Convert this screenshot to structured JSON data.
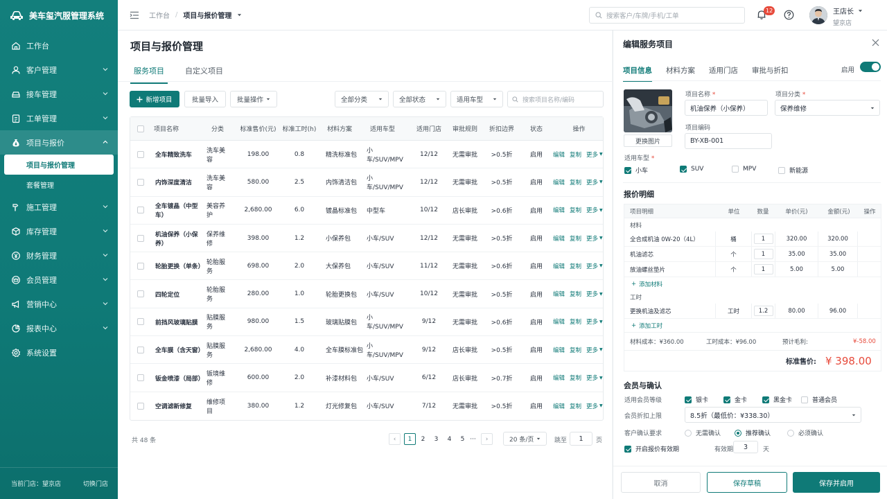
{
  "app": {
    "title": "美车玺汽服管理系统",
    "current_store_label": "当前门店：望京店",
    "switch_store": "切换门店"
  },
  "sidebar": {
    "items": [
      {
        "label": "工作台"
      },
      {
        "label": "客户管理"
      },
      {
        "label": "接车管理"
      },
      {
        "label": "工单管理"
      },
      {
        "label": "项目与报价"
      },
      {
        "label": "施工管理"
      },
      {
        "label": "库存管理"
      },
      {
        "label": "财务管理"
      },
      {
        "label": "会员管理"
      },
      {
        "label": "营销中心"
      },
      {
        "label": "报表中心"
      },
      {
        "label": "系统设置"
      }
    ],
    "sub_items": [
      {
        "label": "项目与报价管理"
      },
      {
        "label": "套餐管理"
      }
    ]
  },
  "topbar": {
    "breadcrumb": [
      "工作台",
      "项目与报价管理"
    ],
    "search_placeholder": "搜索客户/车牌/手机/工单",
    "notification_count": "12",
    "user_name": "王店长",
    "user_store": "望京店"
  },
  "page": {
    "title": "项目与报价管理",
    "tabs": [
      "服务项目",
      "自定义项目"
    ],
    "toolbar": {
      "add": "新增项目",
      "import": "批量导入",
      "batch": "批量操作",
      "category": "全部分类",
      "status": "全部状态",
      "vehicle": "适用车型",
      "search_placeholder": "搜索项目名称/编码"
    },
    "table": {
      "headers": [
        "项目名称",
        "分类",
        "标准售价(元)",
        "标准工时(h)",
        "材料方案",
        "适用车型",
        "适用门店",
        "审批规则",
        "折扣边界",
        "状态",
        "操作"
      ],
      "rows": [
        {
          "name": "全车精致洗车",
          "cat": "洗车美容",
          "price": "198.00",
          "hours": "0.8",
          "material": "精洗标准包",
          "vehicle": "小车/SUV/MPV",
          "stores": "12/12",
          "approval": "无需审批",
          "discount": ">0.5折",
          "status": "启用"
        },
        {
          "name": "内饰深度清洁",
          "cat": "洗车美容",
          "price": "580.00",
          "hours": "2.5",
          "material": "内饰清洁包",
          "vehicle": "小车/SUV/MPV",
          "stores": "12/12",
          "approval": "无需审批",
          "discount": ">0.5折",
          "status": "启用"
        },
        {
          "name": "全车镀晶（中型车）",
          "cat": "美容养护",
          "price": "2,680.00",
          "hours": "6.0",
          "material": "镀晶标准包",
          "vehicle": "中型车",
          "stores": "10/12",
          "approval": "店长审批",
          "discount": ">0.6折",
          "status": "启用"
        },
        {
          "name": "机油保养（小保养）",
          "cat": "保养维修",
          "price": "398.00",
          "hours": "1.2",
          "material": "小保养包",
          "vehicle": "小车/SUV",
          "stores": "12/12",
          "approval": "无需审批",
          "discount": ">0.5折",
          "status": "启用"
        },
        {
          "name": "轮胎更换（单条）",
          "cat": "轮胎服务",
          "price": "698.00",
          "hours": "2.0",
          "material": "大保养包",
          "vehicle": "小车/SUV",
          "stores": "11/12",
          "approval": "无需审批",
          "discount": ">0.6折",
          "status": "启用"
        },
        {
          "name": "四轮定位",
          "cat": "轮胎服务",
          "price": "280.00",
          "hours": "1.0",
          "material": "轮胎更换包",
          "vehicle": "小车/SUV",
          "stores": "10/12",
          "approval": "无需审批",
          "discount": ">0.5折",
          "status": "启用"
        },
        {
          "name": "前挡风玻璃贴膜",
          "cat": "贴膜服务",
          "price": "980.00",
          "hours": "1.5",
          "material": "玻璃贴膜包",
          "vehicle": "小车/SUV/MPV",
          "stores": "9/12",
          "approval": "无需审批",
          "discount": ">0.6折",
          "status": "启用"
        },
        {
          "name": "全车膜（含天窗）",
          "cat": "贴膜服务",
          "price": "2,680.00",
          "hours": "4.0",
          "material": "全车膜标准包",
          "vehicle": "小车/SUV/MPV",
          "stores": "9/12",
          "approval": "店长审批",
          "discount": ">0.5折",
          "status": "启用"
        },
        {
          "name": "钣金喷漆（局部）",
          "cat": "钣境维修",
          "price": "600.00",
          "hours": "2.0",
          "material": "补漆材料包",
          "vehicle": "小车/SUV",
          "stores": "6/12",
          "approval": "店长审批",
          "discount": ">0.7折",
          "status": "启用"
        },
        {
          "name": "空调滤新修复",
          "cat": "维修项目",
          "price": "380.00",
          "hours": "1.2",
          "material": "灯光修复包",
          "vehicle": "小车/SUV",
          "stores": "7/12",
          "approval": "无需审批",
          "discount": ">0.5折",
          "status": "启用"
        }
      ],
      "actions": {
        "edit": "编辑",
        "copy": "复制",
        "more": "更多"
      }
    },
    "pager": {
      "total": "共 48 条",
      "pages": [
        "1",
        "2",
        "3",
        "4",
        "5"
      ],
      "ellipsis": "···",
      "per_page": "20 条/页",
      "jump_label": "跳至",
      "jump_value": "1",
      "page_unit": "页"
    }
  },
  "panel": {
    "title": "编辑服务项目",
    "tabs": [
      "项目信息",
      "材料方案",
      "适用门店",
      "审批与折扣"
    ],
    "enable_label": "启用",
    "photo_btn": "更换图片",
    "name_label": "项目名称",
    "name_value": "机油保养（小保养）",
    "cat_label": "项目分类",
    "cat_value": "保养维修",
    "code_label": "项目编码",
    "code_value": "BY-XB-001",
    "vehicle_label": "适用车型",
    "vehicles": [
      {
        "label": "小车",
        "checked": true
      },
      {
        "label": "SUV",
        "checked": true
      },
      {
        "label": "MPV",
        "checked": false
      },
      {
        "label": "新能源",
        "checked": false
      }
    ],
    "quote": {
      "title": "报价明细",
      "headers": [
        "项目明细",
        "单位",
        "数量",
        "单价(元)",
        "金额(元)",
        "操作"
      ],
      "material_group": "材料",
      "materials": [
        {
          "name": "全合成机油 0W-20（4L）",
          "unit": "桶",
          "qty": "1",
          "price": "320.00",
          "amount": "320.00"
        },
        {
          "name": "机油滤芯",
          "unit": "个",
          "qty": "1",
          "price": "35.00",
          "amount": "35.00"
        },
        {
          "name": "放油螺丝垫片",
          "unit": "个",
          "qty": "1",
          "price": "5.00",
          "amount": "5.00"
        }
      ],
      "add_material": "添加材料",
      "labor_group": "工时",
      "labor": [
        {
          "name": "更换机油及滤芯",
          "unit": "工时",
          "qty": "1.2",
          "price": "80.00",
          "amount": "96.00"
        }
      ],
      "add_labor": "添加工时",
      "material_cost": "材料成本：¥360.00",
      "labor_cost": "工时成本：¥96.00",
      "profit_label": "预计毛利:",
      "profit_value": "¥-58.00",
      "total_label": "标准售价:",
      "total_value": "¥ 398.00"
    },
    "member": {
      "title": "会员与确认",
      "level_label": "适用会员等级",
      "levels": [
        {
          "label": "银卡",
          "checked": true
        },
        {
          "label": "金卡",
          "checked": true
        },
        {
          "label": "黑金卡",
          "checked": true
        },
        {
          "label": "普通会员",
          "checked": false
        }
      ],
      "limit_label": "会员折扣上限",
      "limit_value": "8.5折（最低价：¥338.30）",
      "confirm_label": "客户确认要求",
      "confirm_options": [
        {
          "label": "无需确认",
          "on": false
        },
        {
          "label": "推荐确认",
          "on": true
        },
        {
          "label": "必须确认",
          "on": false
        }
      ],
      "validity_label": "开启报价有效期",
      "validity_days_label": "有效期",
      "validity_days": "3",
      "validity_unit": "天"
    },
    "footer": {
      "cancel": "取消",
      "draft": "保存草稿",
      "save": "保存并启用"
    }
  },
  "colors": {
    "primary": "#0f7a77",
    "danger": "#e74b3c"
  }
}
